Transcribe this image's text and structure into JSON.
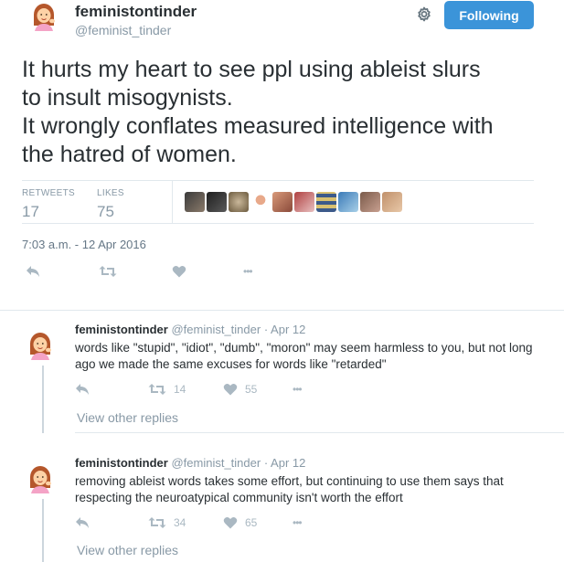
{
  "tweet": {
    "display_name": "feministontinder",
    "screen_name": "@feminist_tinder",
    "follow_label": "Following",
    "text": "It hurts my heart to see ppl using ableist slurs\nto insult misogynists.\nIt wrongly conflates measured intelligence with\nthe hatred of women.",
    "retweets_label": "RETWEETS",
    "retweets_count": "17",
    "likes_label": "LIKES",
    "likes_count": "75",
    "timestamp": "7:03 a.m. - 12 Apr 2016",
    "more_glyph": "•••"
  },
  "replies": [
    {
      "display_name": "feministontinder",
      "meta": "@feminist_tinder · Apr 12",
      "text": "words like \"stupid\", \"idiot\", \"dumb\", \"moron\" may seem harmless to you, but not long ago we made the same excuses for words like \"retarded\"",
      "retweets": "14",
      "likes": "55",
      "view_more": "View other replies"
    },
    {
      "display_name": "feministontinder",
      "meta": "@feminist_tinder · Apr 12",
      "text": "removing ableist words takes some effort, but continuing to use them says that respecting the neuroatypical community isn't worth the effort",
      "retweets": "34",
      "likes": "65",
      "view_more": "View other replies"
    }
  ],
  "colors": {
    "follow_bg": "#3b94d9",
    "muted": "#8899a6",
    "icon": "#aab8c2",
    "border": "#e1e8ed"
  },
  "icons": [
    "woman-tipping-hand-emoji-icon",
    "gear-icon",
    "reply-icon",
    "retweet-icon",
    "heart-icon",
    "more-icon"
  ]
}
